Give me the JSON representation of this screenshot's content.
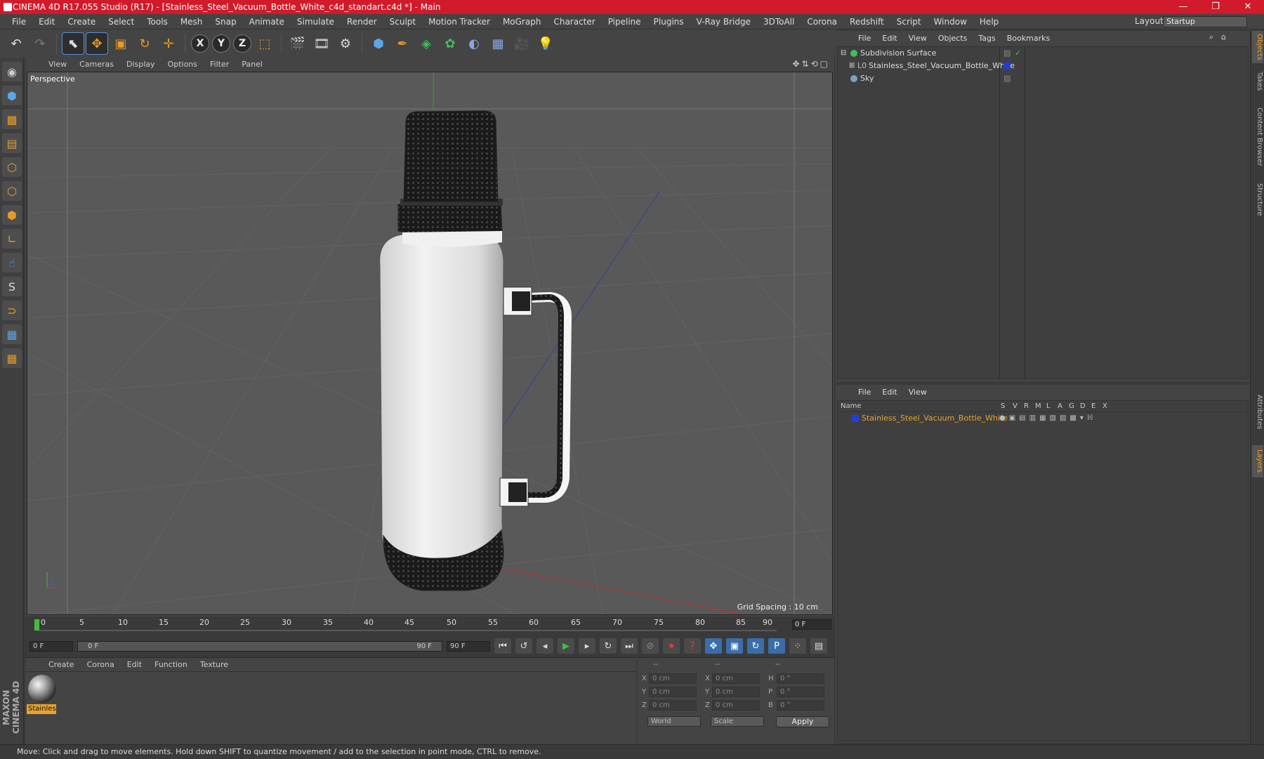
{
  "window": {
    "title": "CINEMA 4D R17.055 Studio (R17) - [Stainless_Steel_Vacuum_Bottle_White_c4d_standart.c4d *] - Main",
    "minimize": "—",
    "maximize": "❐",
    "close": "✕"
  },
  "menubar": [
    "File",
    "Edit",
    "Create",
    "Select",
    "Tools",
    "Mesh",
    "Snap",
    "Animate",
    "Simulate",
    "Render",
    "Sculpt",
    "Motion Tracker",
    "MoGraph",
    "Character",
    "Pipeline",
    "Plugins",
    "V-Ray Bridge",
    "3DToAll",
    "Corona",
    "Redshift",
    "Script",
    "Window",
    "Help"
  ],
  "layout": {
    "label": "Layout:",
    "value": "Startup"
  },
  "axes": {
    "x": "X",
    "y": "Y",
    "z": "Z"
  },
  "viewport": {
    "menu": [
      "View",
      "Cameras",
      "Display",
      "Options",
      "Filter",
      "Panel"
    ],
    "label": "Perspective",
    "grid_spacing": "Grid Spacing : 10 cm"
  },
  "timeline": {
    "ticks": [
      "0",
      "5",
      "10",
      "15",
      "20",
      "25",
      "30",
      "35",
      "40",
      "45",
      "50",
      "55",
      "60",
      "65",
      "70",
      "75",
      "80",
      "85",
      "90"
    ],
    "current_frame": "0 F"
  },
  "transport": {
    "start": "0 F",
    "range_start": "0 F",
    "range_end": "90 F",
    "end": "90 F"
  },
  "materials": {
    "menu": [
      "Create",
      "Corona",
      "Edit",
      "Function",
      "Texture"
    ],
    "items": [
      {
        "name": "Stainles"
      }
    ]
  },
  "coords": {
    "headers": [
      "--",
      "--",
      "--"
    ],
    "rows": [
      {
        "a": "X",
        "v1": "0 cm",
        "b": "X",
        "v2": "0 cm",
        "c": "H",
        "v3": "0 °"
      },
      {
        "a": "Y",
        "v1": "0 cm",
        "b": "Y",
        "v2": "0 cm",
        "c": "P",
        "v3": "0 °"
      },
      {
        "a": "Z",
        "v1": "0 cm",
        "b": "Z",
        "v2": "0 cm",
        "c": "B",
        "v3": "0 °"
      }
    ],
    "world": "World",
    "scale": "Scale",
    "apply": "Apply"
  },
  "objects": {
    "menu": [
      "File",
      "Edit",
      "View",
      "Objects",
      "Tags",
      "Bookmarks"
    ],
    "items": [
      {
        "name": "Subdivision Surface",
        "color": "#3fbf5f"
      },
      {
        "name": "Stainless_Steel_Vacuum_Bottle_White",
        "color": "#9a9a9a"
      },
      {
        "name": "Sky",
        "color": "#7aa0c8"
      }
    ]
  },
  "layers": {
    "menu": [
      "File",
      "Edit",
      "View"
    ],
    "headers": [
      "Name",
      "S",
      "V",
      "R",
      "M",
      "L",
      "A",
      "G",
      "D",
      "E",
      "X"
    ],
    "items": [
      {
        "name": "Stainless_Steel_Vacuum_Bottle_White",
        "color": "#1f3fd8"
      }
    ]
  },
  "right_tabs": [
    "Objects",
    "Takes",
    "Content Browser",
    "Structure",
    "Attributes",
    "Layers"
  ],
  "status": "Move: Click and drag to move elements. Hold down SHIFT to quantize movement / add to the selection in point mode, CTRL to remove.",
  "brand": "MAXON CINEMA 4D"
}
